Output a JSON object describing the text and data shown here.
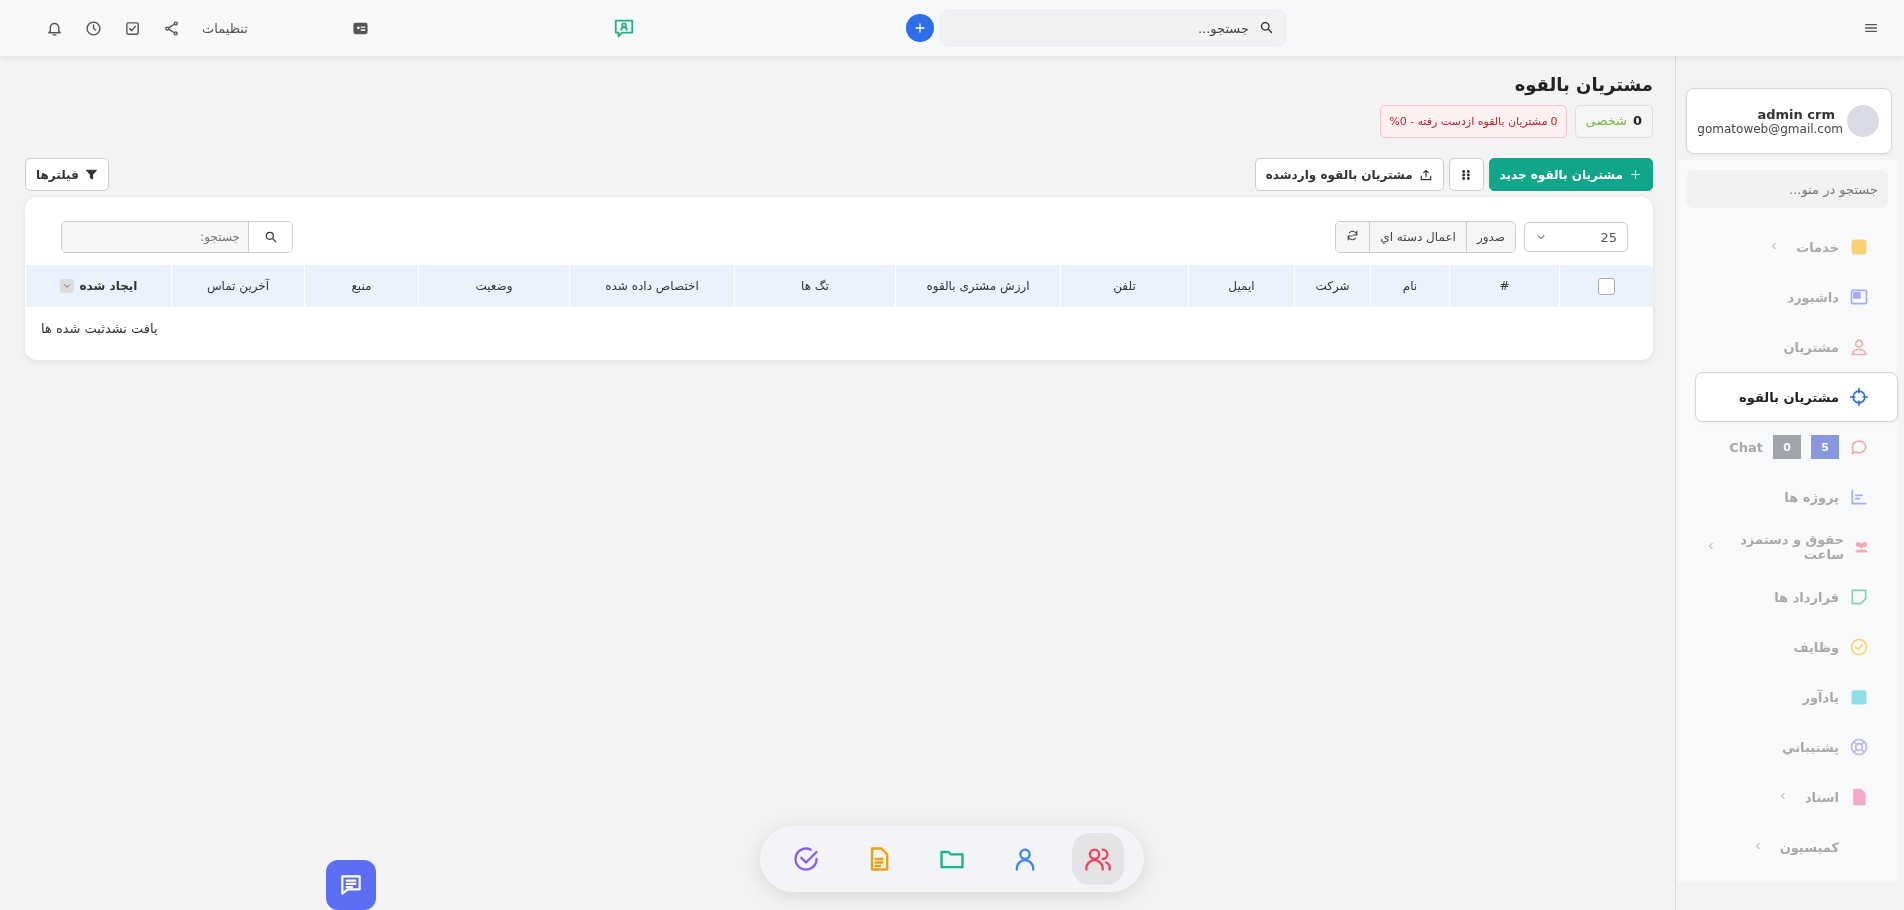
{
  "top_bar": {
    "search": {
      "placeholder": "جستجو..."
    },
    "settings_label": "تنظیمات"
  },
  "page": {
    "title": "مشتریان بالقوه",
    "stats": [
      {
        "value": "0",
        "label": "شخصی",
        "kind": "neutral"
      },
      {
        "value": "0",
        "label": "مشتریان بالقوه ازدست رفته - 0%",
        "kind": "danger"
      }
    ],
    "buttons": [
      {
        "label": "مشتریان بالقوه جدید",
        "kind": "primary"
      },
      {
        "kind": "grid"
      },
      {
        "label": "مشتریان بالقوه واردشده",
        "kind": "upload"
      }
    ],
    "filters_button": "فیلترها"
  },
  "table_toolbar": {
    "page_size": "25",
    "actions": [
      "صدور",
      "اعمال دسته اي"
    ],
    "search": {
      "placeholder": "جستجو:"
    }
  },
  "table": {
    "columns": [
      {
        "label": "#"
      },
      {
        "label": "نام"
      },
      {
        "label": "شرکت"
      },
      {
        "label": "ایمیل"
      },
      {
        "label": "تلفن"
      },
      {
        "label": "ارزش مشتری بالقوه"
      },
      {
        "label": "تگ ها"
      },
      {
        "label": "اختصاص داده شده"
      },
      {
        "label": "وضعیت"
      },
      {
        "label": "منبع"
      },
      {
        "label": "آخرین تماس"
      },
      {
        "label": "ایجاد شده",
        "sorted": true
      }
    ],
    "select_all": {
      "checked": false
    },
    "empty_message": "یافت نشدثبت شده ها"
  },
  "user": {
    "name": "admin crm",
    "email": "gomatoweb@gmail.com"
  },
  "sidebar": {
    "search": {
      "placeholder": "جستجو در منو..."
    },
    "items": [
      {
        "label": "خدمات",
        "selected": false,
        "expandable": true
      },
      {
        "label": "داشبورد",
        "selected": false,
        "expandable": false
      },
      {
        "label": "مشتریان",
        "selected": false,
        "expandable": false
      },
      {
        "label": "مشتریان بالقوه",
        "selected": true,
        "expandable": false
      },
      {
        "label": "Chat",
        "selected": false,
        "expandable": false,
        "badges": [
          {
            "text": "5",
            "kind": "primary"
          },
          {
            "text": "0",
            "kind": "secondary"
          }
        ]
      },
      {
        "label": "پروژه ها",
        "selected": false,
        "expandable": false
      },
      {
        "label": "حقوق و دستمزد ساعت",
        "selected": false,
        "expandable": true
      },
      {
        "label": "قرارداد ها",
        "selected": false,
        "expandable": false
      },
      {
        "label": "وظایف",
        "selected": false,
        "expandable": false
      },
      {
        "label": "یادآور",
        "selected": false,
        "expandable": false
      },
      {
        "label": "پشتيباني",
        "selected": false,
        "expandable": false
      },
      {
        "label": "اسناد",
        "selected": false,
        "expandable": true
      },
      {
        "label": "کمیسیون",
        "selected": false,
        "expandable": true
      }
    ]
  },
  "dock": [
    {
      "selected": false
    },
    {
      "selected": false
    },
    {
      "selected": false
    },
    {
      "selected": false
    },
    {
      "selected": true
    }
  ]
}
